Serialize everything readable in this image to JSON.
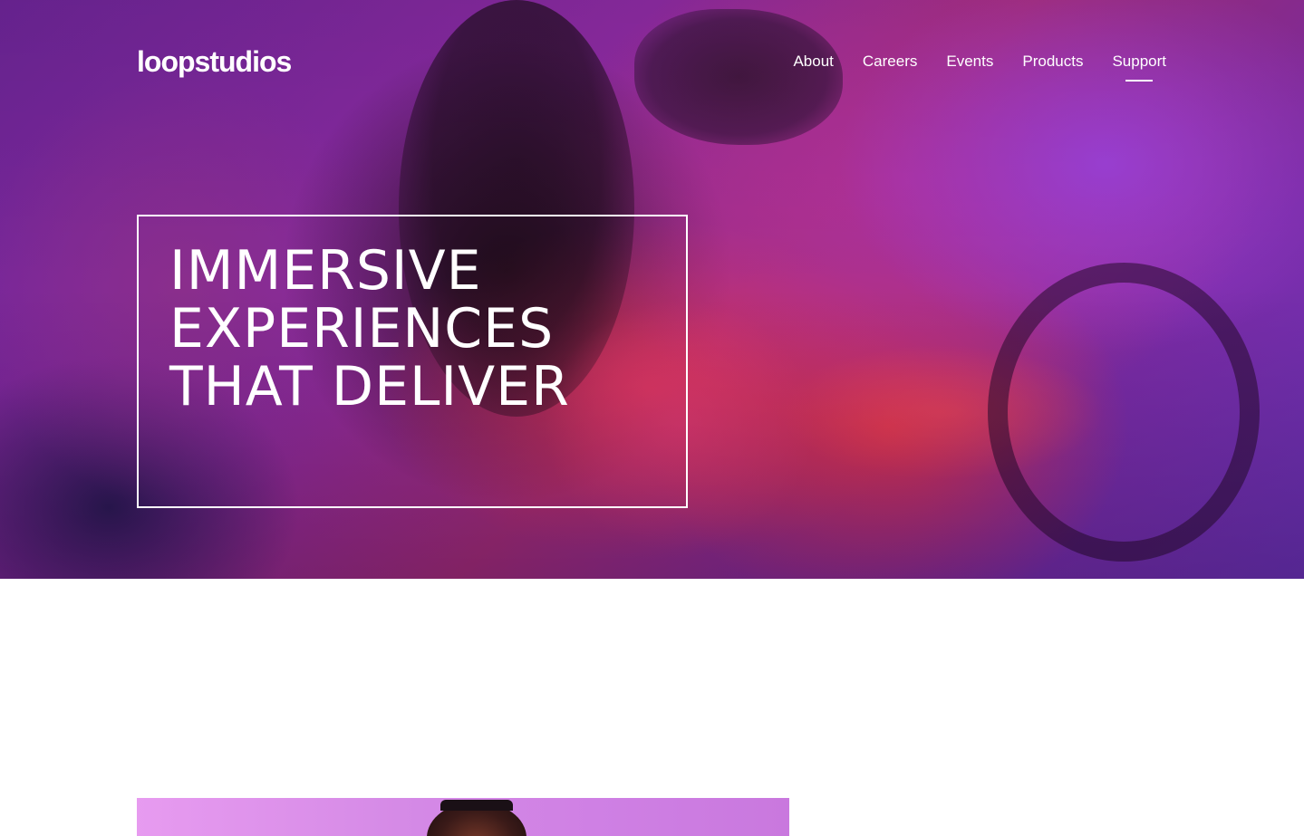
{
  "header": {
    "logo_text": "loopstudios",
    "nav": [
      {
        "label": "About"
      },
      {
        "label": "Careers"
      },
      {
        "label": "Events"
      },
      {
        "label": "Products"
      },
      {
        "label": "Support",
        "active": true
      }
    ]
  },
  "hero": {
    "title": "Immersive experiences that deliver",
    "background_colors": [
      "#6a2494",
      "#b0319c",
      "#e0334f",
      "#2a0f22",
      "#6a33b8"
    ]
  },
  "interactive_section": {
    "image_colors": [
      "#e79bf0",
      "#c978de"
    ]
  }
}
